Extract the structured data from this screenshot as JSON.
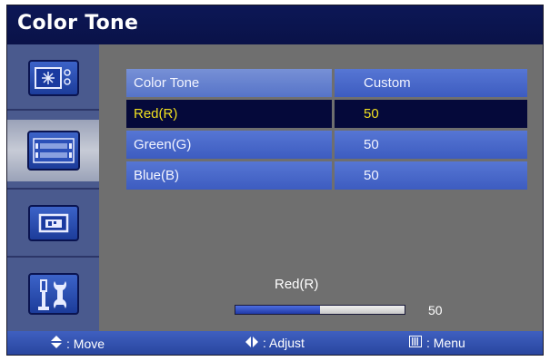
{
  "title": "Color Tone",
  "table": {
    "rows": [
      {
        "label": "Color Tone",
        "value": "Custom"
      },
      {
        "label": "Red(R)",
        "value": "50"
      },
      {
        "label": "Green(G)",
        "value": "50"
      },
      {
        "label": "Blue(B)",
        "value": "50"
      }
    ]
  },
  "adjust": {
    "label": "Red(R)",
    "value": "50",
    "level_fraction": 0.5
  },
  "footer": {
    "move": ": Move",
    "adjust": ": Adjust",
    "menu": ": Menu"
  },
  "icons": {
    "sidebar": [
      "picture-icon",
      "color-settings-icon",
      "pip-icon",
      "setup-tools-icon"
    ],
    "footer": [
      "up-down-arrows-icon",
      "left-right-arrows-icon",
      "menu-button-icon"
    ]
  },
  "colors": {
    "selected_text": "#f0e020",
    "title_bar": "#0a1248",
    "cell_blue": "#4665c8"
  }
}
